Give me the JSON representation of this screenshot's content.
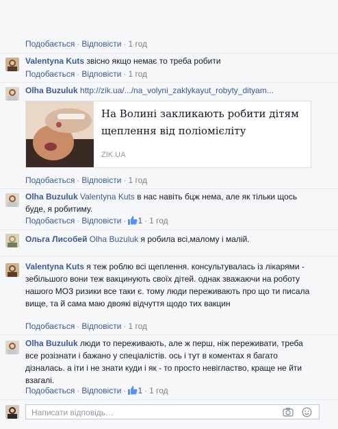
{
  "actions": {
    "like": "Подобається",
    "reply": "Відповісти",
    "sep": "·"
  },
  "comments": [
    {
      "author": "",
      "text": "",
      "time": "1 год",
      "likes": ""
    },
    {
      "author": "Valentyna Kuts",
      "text": "звісно якщо немає то треба робити",
      "time": "1 год"
    },
    {
      "author": "Olha Buzuluk",
      "url": "http://zik.ua/.../na_volyni_zaklykayut_robyty_dityam...",
      "time": "1 год"
    },
    {
      "author": "Olha Buzuluk",
      "mention": "Valentyna Kuts",
      "text": "в нас навіть бцж нема, але як тільки щось буде, я робитиму.",
      "time": "1 год",
      "likes": "1"
    },
    {
      "author": "Ольга Лисобей",
      "mention": "Olha Buzuluk",
      "text": "я робила всі,малому і малій."
    },
    {
      "author": "Valentyna Kuts",
      "text": "я теж роблю всі щеплення. консультувалась із лікарями - зебільшого вони теж вакцинують своїх дітей. однак зважаючи на роботу нашого МОЗ ризики все таки є. тому люди переживають про що ти писала вище, та й сама маю двоякі відчуття щодо тих вакцин",
      "time": "1 год"
    },
    {
      "author": "Olha Buzuluk",
      "text": "люди то переживають, але ж перш, ніж переживати, треба все розізнати і бажано у спеціалістів. ось і тут в коментах я багато дізналась. а іти і не знати куди і як - то просто невігластво, краще не йти взагалі.",
      "time": "1 год",
      "likes": "1"
    }
  ],
  "link_card": {
    "title": "На Волині закликають робити дітям щеплення від поліомієліту",
    "source": "ZIK.UA"
  },
  "reply_box": {
    "placeholder": "Написати відповідь…"
  },
  "icons": [
    "like-icon",
    "camera-icon",
    "smiley-icon"
  ],
  "colors": {
    "link": "#3b5998",
    "meta": "#9197a3",
    "panel": "#f6f7f9",
    "like": "#5890ff"
  }
}
